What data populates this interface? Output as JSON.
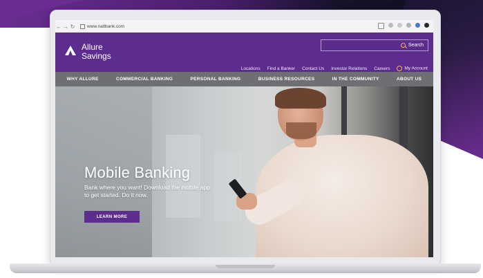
{
  "browser": {
    "url": "www.natlbank.com"
  },
  "site": {
    "logo_line1": "Allure",
    "logo_line2": "Savings",
    "search_label": "Search",
    "util_links": [
      "Locations",
      "Find a Banker",
      "Contact Us",
      "Investor Relations",
      "Careers"
    ],
    "account_label": "My Account"
  },
  "main_nav": [
    "WHY ALLURE",
    "COMMERCIAL BANKING",
    "PERSONAL BANKING",
    "BUSINESS RESOURCES",
    "IN THE COMMUNITY",
    "ABOUT US"
  ],
  "hero": {
    "title": "Mobile Banking",
    "subtitle": "Bank where you want! Download the mobile app to get started. Do it now.",
    "button_label": "LEARN MORE"
  },
  "colors": {
    "brand_purple": "#5c2d8f",
    "nav_gray": "#6d6f72",
    "accent_orange": "#ffb347"
  }
}
